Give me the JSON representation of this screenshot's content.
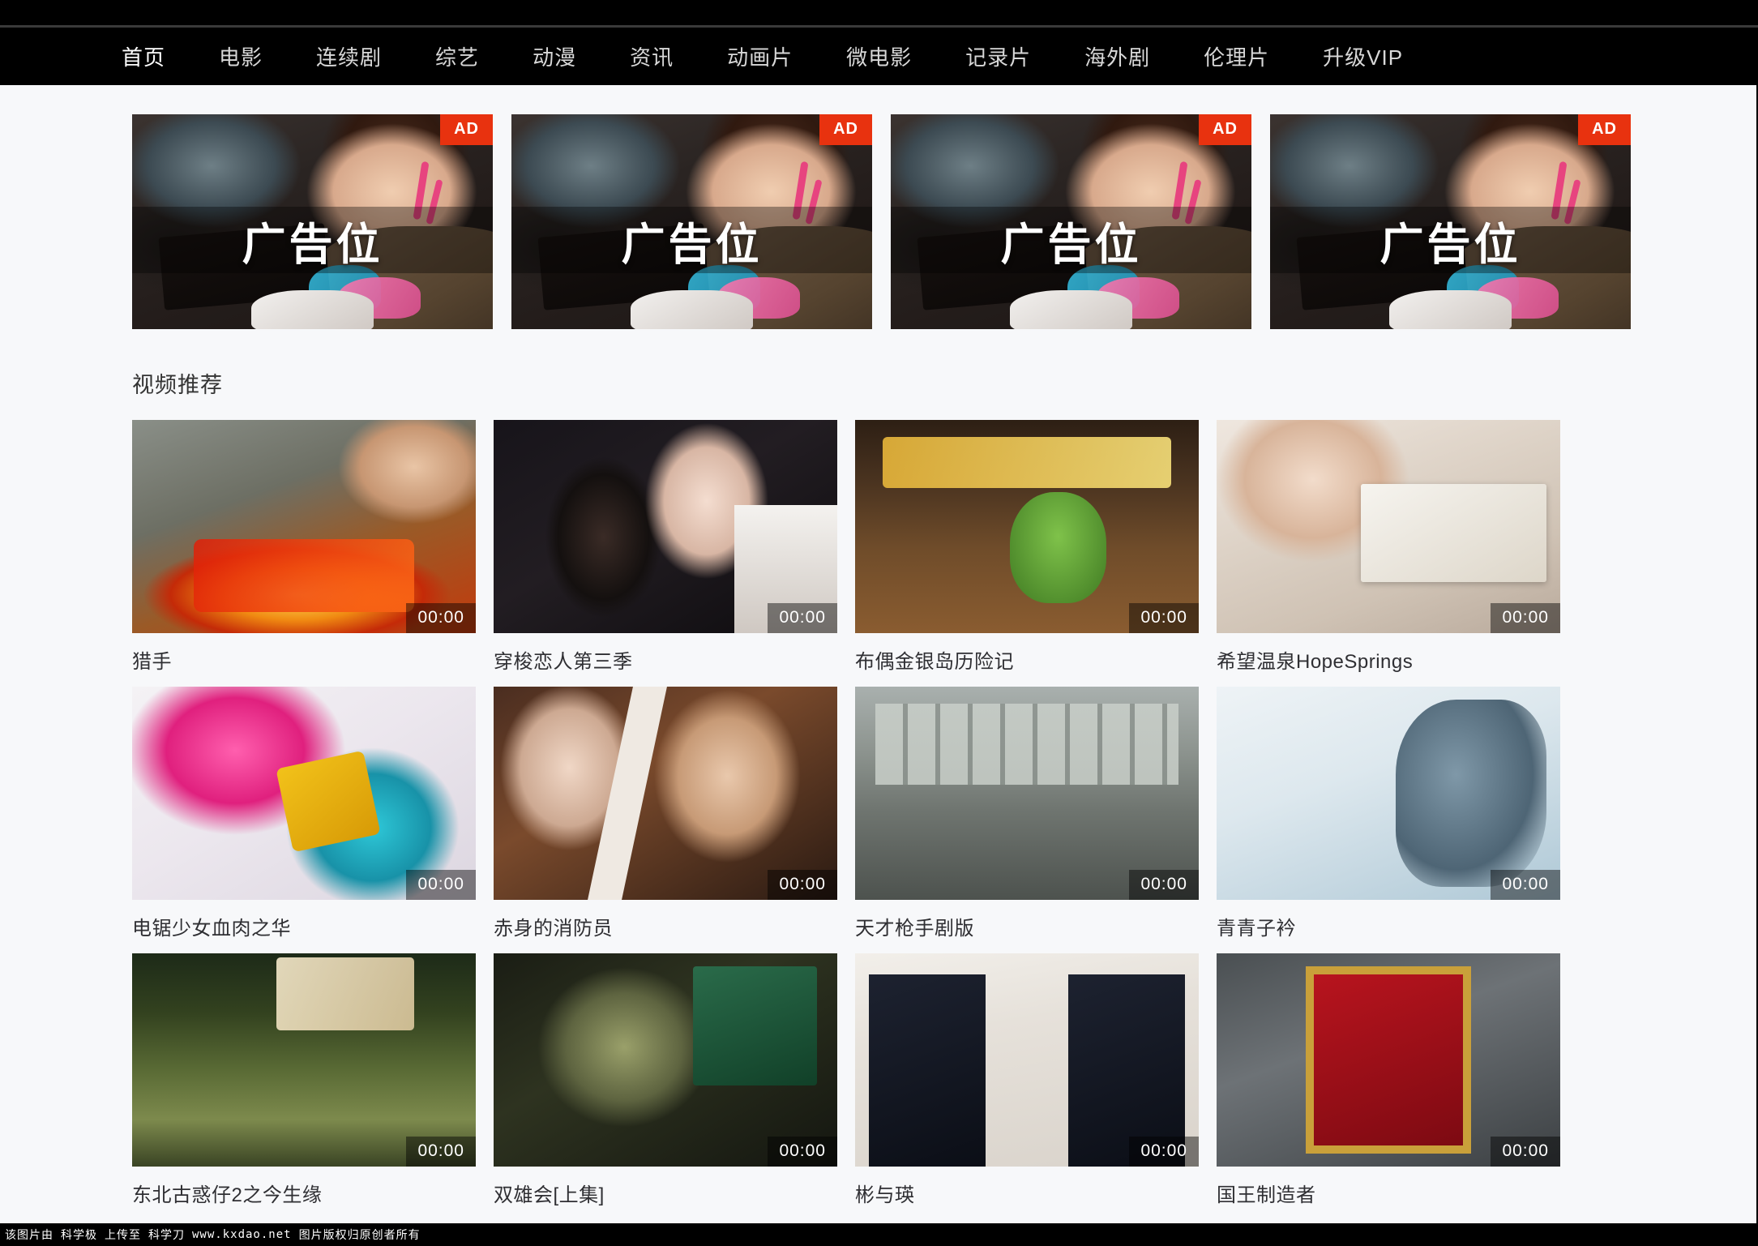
{
  "nav": {
    "items": [
      {
        "label": "首页",
        "active": true
      },
      {
        "label": "电影",
        "active": false
      },
      {
        "label": "连续剧",
        "active": false
      },
      {
        "label": "综艺",
        "active": false
      },
      {
        "label": "动漫",
        "active": false
      },
      {
        "label": "资讯",
        "active": false
      },
      {
        "label": "动画片",
        "active": false
      },
      {
        "label": "微电影",
        "active": false
      },
      {
        "label": "记录片",
        "active": false
      },
      {
        "label": "海外剧",
        "active": false
      },
      {
        "label": "伦理片",
        "active": false
      },
      {
        "label": "升级VIP",
        "active": false
      }
    ]
  },
  "ads": {
    "badge_label": "AD",
    "badge_color": "#e8320f",
    "items": [
      {
        "caption": "广告位"
      },
      {
        "caption": "广告位"
      },
      {
        "caption": "广告位"
      },
      {
        "caption": "广告位"
      }
    ]
  },
  "section": {
    "title": "视频推荐"
  },
  "videos": [
    {
      "title": "猎手",
      "duration": "00:00",
      "art": "art-lieshou"
    },
    {
      "title": "穿梭恋人第三季",
      "duration": "00:00",
      "art": "art-chuansuo"
    },
    {
      "title": "布偶金银岛历险记",
      "duration": "00:00",
      "art": "art-bouou"
    },
    {
      "title": "希望温泉HopeSprings",
      "duration": "00:00",
      "art": "art-hope"
    },
    {
      "title": "电锯少女血肉之华",
      "duration": "00:00",
      "art": "art-dianju"
    },
    {
      "title": "赤身的消防员",
      "duration": "00:00",
      "art": "art-chishen"
    },
    {
      "title": "天才枪手剧版",
      "duration": "00:00",
      "art": "art-tiancai"
    },
    {
      "title": "青青子衿",
      "duration": "00:00",
      "art": "art-qingqing"
    },
    {
      "title": "东北古惑仔2之今生缘",
      "duration": "00:00",
      "art": "art-dongbei"
    },
    {
      "title": "双雄会[上集]",
      "duration": "00:00",
      "art": "art-shuangxiong"
    },
    {
      "title": "彬与瑛",
      "duration": "00:00",
      "art": "art-binyu"
    },
    {
      "title": "国王制造者",
      "duration": "00:00",
      "art": "art-guowang"
    }
  ],
  "footer": {
    "part1": "该图片由",
    "part2": "科学极",
    "part3": "上传至",
    "part4": "科学刀",
    "part5": "www.kxdao.net",
    "part6": "图片版权归原创者所有"
  }
}
